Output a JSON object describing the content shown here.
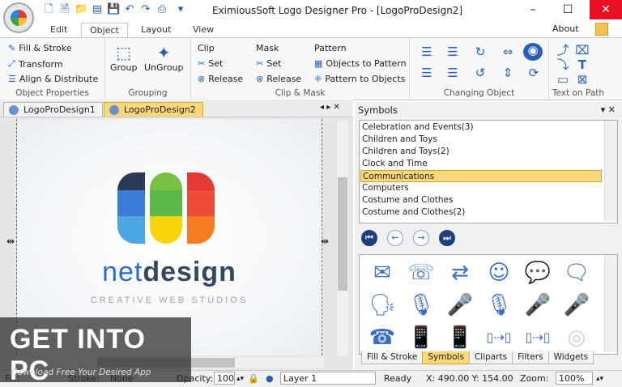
{
  "window": {
    "title": "EximiousSoft Logo Designer Pro - [LogoProDesign2]",
    "minimize": "–",
    "maximize": "☐",
    "close": "✕"
  },
  "menu_tabs": [
    "Edit",
    "Object",
    "Layout",
    "View"
  ],
  "about_label": "About",
  "ribbon": {
    "object_properties": {
      "label": "Object Properties",
      "items": [
        "Fill & Stroke",
        "Transform",
        "Align & Distribute"
      ]
    },
    "grouping": {
      "label": "Grouping",
      "group": "Group",
      "ungroup": "UnGroup"
    },
    "clip": {
      "title": "Clip",
      "set": "Set",
      "release": "Release"
    },
    "mask": {
      "title": "Mask",
      "set": "Set",
      "release": "Release"
    },
    "clip_mask_label": "Clip & Mask",
    "pattern": {
      "title": "Pattern",
      "to_pattern": "Objects to Pattern",
      "to_objects": "Pattern to Objects"
    },
    "changing_object_label": "Changing Object",
    "text_on_path_label": "Text on Path"
  },
  "doc_tabs": [
    {
      "label": "LogoProDesign1",
      "active": false
    },
    {
      "label": "LogoProDesign2",
      "active": true
    }
  ],
  "canvas": {
    "logo_text_a": "net",
    "logo_text_b": "design",
    "logo_subtitle": "CREATIVE WEB STUDIOS",
    "colors": {
      "blue_dark": "#2b3a55",
      "blue": "#3a7bd5",
      "light_blue": "#4ca6e0",
      "green": "#7ac143",
      "yellow": "#f9d30c",
      "red": "#e53935",
      "orange": "#f57c20",
      "text_blue": "#2b6cc4",
      "text_dark": "#34495e"
    }
  },
  "symbols_panel": {
    "title": "Symbols",
    "items": [
      "Celebration and Events(3)",
      "Children and Toys",
      "Children and Toys(2)",
      "Clock and Time",
      "Communications",
      "Computers",
      "Costume and Clothes",
      "Costume and Clothes(2)"
    ],
    "selected_index": 4,
    "nav": [
      "⏮",
      "←",
      "→",
      "⏭"
    ],
    "bottom_tabs": [
      "Fill & Stroke",
      "Symbols",
      "Cliparts",
      "Filters",
      "Widgets"
    ],
    "active_tab": "Symbols",
    "gallery_icons": [
      "mail-icon",
      "person-phone-icon",
      "arrows-icon",
      "face-sound-icon",
      "chat-bubble-icon",
      "chat-bubbles-icon",
      "speaking-head-icon",
      "microphone-icon",
      "microphone-stand-icon",
      "microphone-icon-2",
      "microphone-desk-icon",
      "microphone-handheld-icon",
      "telephone-icon",
      "mobile-phone-icon",
      "mobile-phone-icon-2",
      "phone-transfer-icon",
      "phone-transfer-icon-2",
      "mobile-phone-icon-3"
    ]
  },
  "statusbar": {
    "fill_label": "Fill:",
    "stroke_label": "Stroke:",
    "stroke_value": "None",
    "opacity_label": "Opacity:",
    "opacity_value": "100",
    "layer_value": "Layer 1",
    "ready": "Ready",
    "coords": "X: 490.00 Y: 154.00",
    "zoom_label": "Zoom:",
    "zoom_value": "100%"
  },
  "watermark": {
    "title": "GET INTO PC",
    "subtitle": "Download Free Your Desired App"
  }
}
